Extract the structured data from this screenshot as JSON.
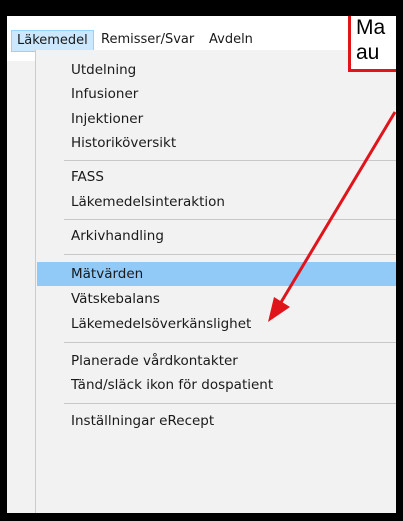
{
  "menubar": {
    "items": [
      {
        "label": "Läkemedel",
        "active": true
      },
      {
        "label": "Remisser/Svar",
        "active": false
      },
      {
        "label": "Avdeln",
        "active": false
      }
    ]
  },
  "dropdown": {
    "items": [
      {
        "label": "Utdelning"
      },
      {
        "label": "Infusioner"
      },
      {
        "label": "Injektioner"
      },
      {
        "label": "Historiköversikt"
      },
      {
        "label": "FASS"
      },
      {
        "label": "Läkemedelsinteraktion"
      },
      {
        "label": "Arkivhandling"
      },
      {
        "label": "Mätvärden",
        "selected": true
      },
      {
        "label": "Vätskebalans"
      },
      {
        "label": "Läkemedelsöverkänslighet"
      },
      {
        "label": "Planerade vårdkontakter"
      },
      {
        "label": "Tänd/släck ikon för dospatient"
      },
      {
        "label": "Inställningar eRecept"
      }
    ]
  },
  "callout": {
    "line1": "Ma",
    "line2": "au"
  },
  "colors": {
    "highlight": "#91c9f7",
    "callout_border": "#e0141b",
    "arrow": "#e0141b"
  }
}
